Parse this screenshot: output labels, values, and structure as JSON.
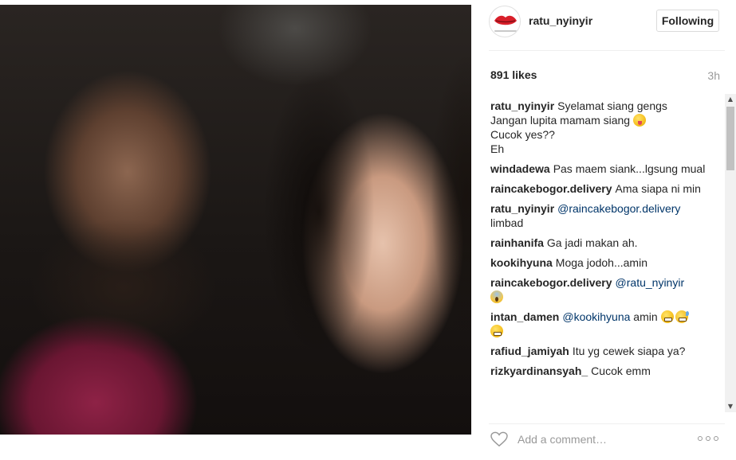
{
  "post": {
    "image_description_name": "selfie-photo"
  },
  "header": {
    "username": "ratu_nyinyir",
    "follow_label": "Following"
  },
  "stats": {
    "likes": "891 likes",
    "time_ago": "3h"
  },
  "comments": [
    {
      "user": "ratu_nyinyir",
      "lines": [
        "Syelamat siang gengs",
        "Jangan lupita mamam siang"
      ],
      "emoji": "tongue-icon",
      "extra": [
        "Cucok yes??",
        "Eh"
      ]
    },
    {
      "user": "windadewa",
      "text": "Pas maem siank...lgsung mual"
    },
    {
      "user": "raincakebogor.delivery",
      "text": "Ama siapa ni min"
    },
    {
      "user": "ratu_nyinyir",
      "mention": "@raincakebogor.delivery",
      "text": "limbad"
    },
    {
      "user": "rainhanifa",
      "text": "Ga jadi makan ah."
    },
    {
      "user": "kookihyuna",
      "text": "Moga jodoh...amin"
    },
    {
      "user": "raincakebogor.delivery",
      "mention": "@ratu_nyinyir",
      "emoji": "scream-icon"
    },
    {
      "user": "intan_damen",
      "mention": "@kookihyuna",
      "text": "amin",
      "emojis": [
        "grin-icon",
        "sweat-smile-icon",
        "grin-icon"
      ]
    },
    {
      "user": "rafiud_jamiyah",
      "text": "Itu yg cewek siapa ya?"
    },
    {
      "user": "rizkyardinansyah_",
      "text": "Cucok emm"
    }
  ],
  "footer": {
    "comment_placeholder": "Add a comment…"
  },
  "colors": {
    "mention": "#003569",
    "muted": "#999999",
    "text": "#262626"
  }
}
